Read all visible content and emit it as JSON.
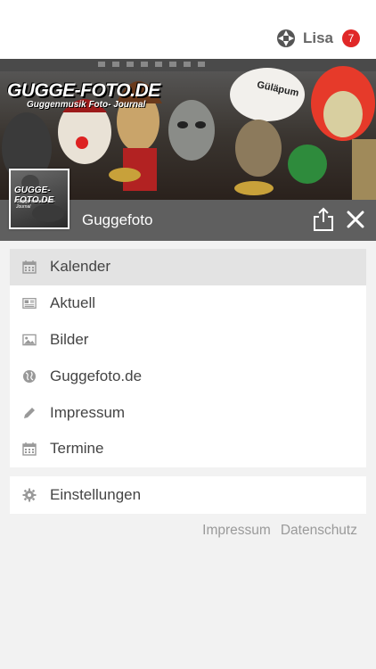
{
  "user": {
    "name": "Lisa",
    "badge_count": "7",
    "logo_icon": "app-logo-icon"
  },
  "banner": {
    "brand_title": "GUGGE-FOTO.DE",
    "brand_subtitle": "Guggenmusik Foto- Journal",
    "band_name": "Güläpum"
  },
  "header": {
    "title": "Guggefoto",
    "share_icon": "share-icon",
    "close_icon": "close-icon",
    "background_color": "#5f5f5f"
  },
  "menu": {
    "items": [
      {
        "label": "Kalender",
        "icon": "calendar-icon",
        "active": true
      },
      {
        "label": "Aktuell",
        "icon": "newspaper-icon",
        "active": false
      },
      {
        "label": "Bilder",
        "icon": "image-icon",
        "active": false
      },
      {
        "label": "Guggefoto.de",
        "icon": "globe-icon",
        "active": false
      },
      {
        "label": "Impressum",
        "icon": "pencil-icon",
        "active": false
      },
      {
        "label": "Termine",
        "icon": "calendar-icon",
        "active": false
      }
    ]
  },
  "settings": {
    "label": "Einstellungen",
    "icon": "gear-icon"
  },
  "footer": {
    "impressum": "Impressum",
    "datenschutz": "Datenschutz"
  },
  "colors": {
    "badge": "#e02727",
    "active_row": "#e3e3e3",
    "text": "#444444",
    "footer_text": "#9a9a9a"
  }
}
